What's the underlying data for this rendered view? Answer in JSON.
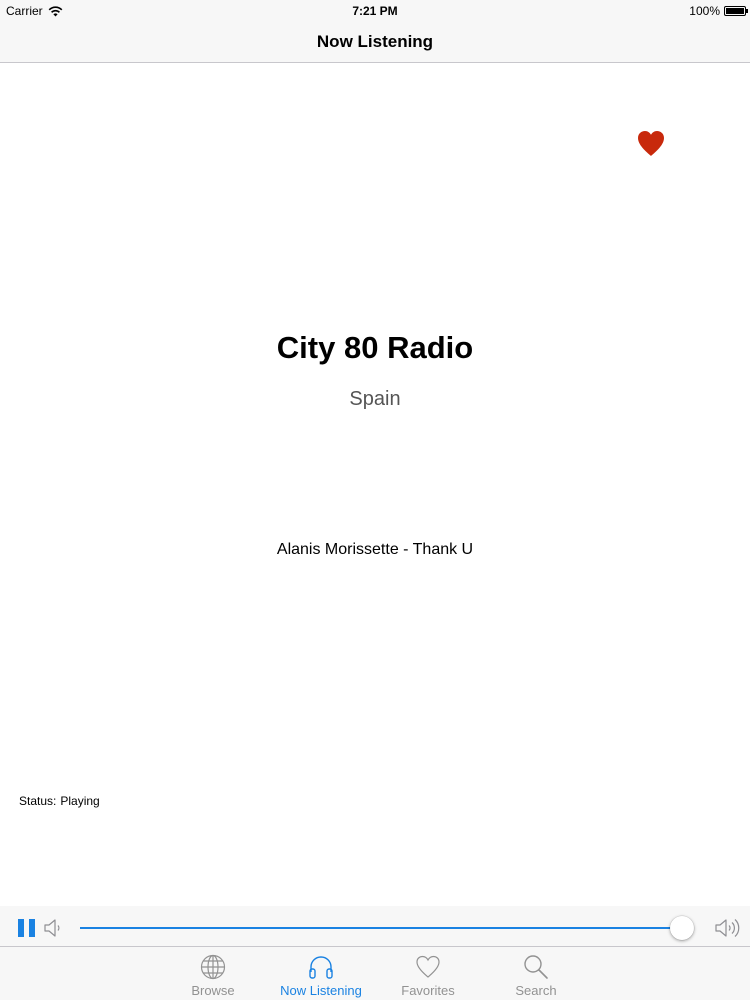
{
  "status_bar": {
    "carrier": "Carrier",
    "time": "7:21 PM",
    "battery": "100%"
  },
  "nav": {
    "title": "Now Listening"
  },
  "station": {
    "name": "City 80 Radio",
    "country": "Spain",
    "track": "Alanis Morissette - Thank U",
    "favorite": true
  },
  "status": {
    "label": "Status:",
    "value": "Playing"
  },
  "player": {
    "volume": 0.98
  },
  "tabs": [
    {
      "label": "Browse",
      "icon": "globe-icon",
      "active": false
    },
    {
      "label": "Now Listening",
      "icon": "headphones-icon",
      "active": true
    },
    {
      "label": "Favorites",
      "icon": "heart-outline-icon",
      "active": false
    },
    {
      "label": "Search",
      "icon": "search-icon",
      "active": false
    }
  ],
  "colors": {
    "accent": "#1a82e2",
    "favorite": "#c8290c",
    "inactive": "#929292"
  }
}
